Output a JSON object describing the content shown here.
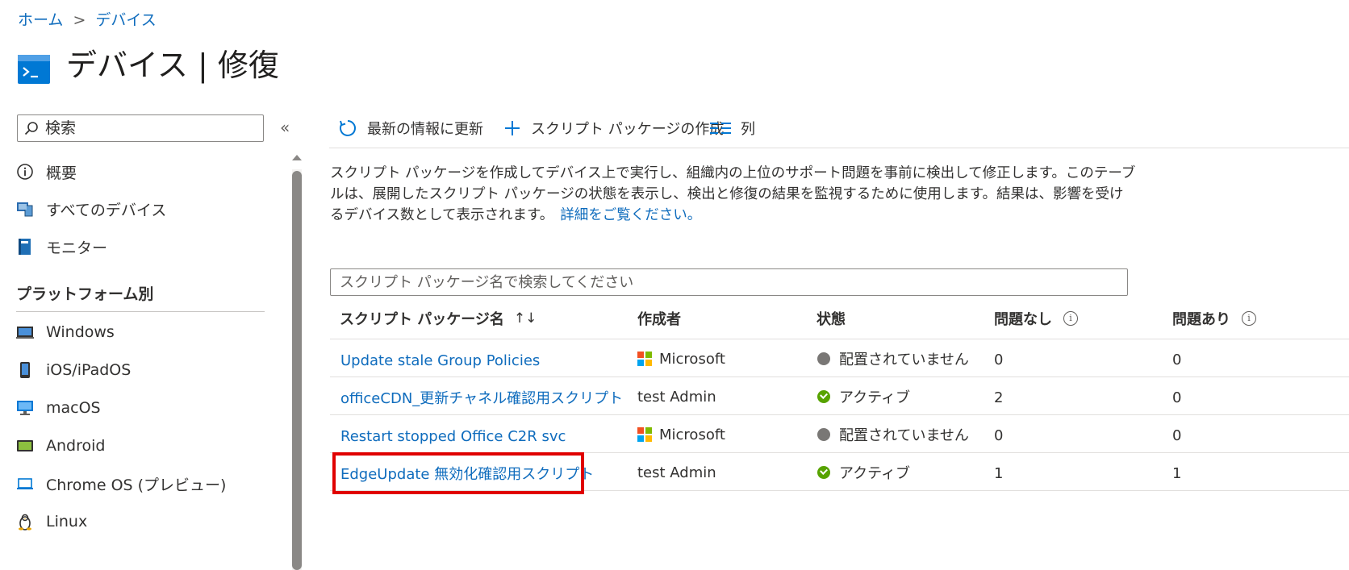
{
  "breadcrumb": {
    "home": "ホーム",
    "separator": ">",
    "current": "デバイス"
  },
  "page": {
    "title": "デバイス | 修復",
    "more": "···"
  },
  "sidebar": {
    "search_placeholder": "検索",
    "collapse": "«",
    "items": [
      {
        "label": "概要",
        "icon": "info-icon"
      },
      {
        "label": "すべてのデバイス",
        "icon": "devices-icon"
      },
      {
        "label": "モニター",
        "icon": "monitor-book-icon"
      }
    ],
    "section_title": "プラットフォーム別",
    "platforms": [
      {
        "label": "Windows",
        "icon": "windows-laptop-icon"
      },
      {
        "label": "iOS/iPadOS",
        "icon": "phone-icon"
      },
      {
        "label": "macOS",
        "icon": "desktop-icon"
      },
      {
        "label": "Android",
        "icon": "android-device-icon"
      },
      {
        "label": "Chrome OS (プレビュー)",
        "icon": "laptop-icon"
      },
      {
        "label": "Linux",
        "icon": "linux-icon"
      }
    ]
  },
  "toolbar": {
    "refresh": "最新の情報に更新",
    "create": "スクリプト パッケージの作成",
    "columns": "列"
  },
  "description": {
    "text": "スクリプト パッケージを作成してデバイス上で実行し、組織内の上位のサポート問題を事前に検出して修正します。このテーブルは、展開したスクリプト パッケージの状態を表示し、検出と修復の結果を監視するために使用します。結果は、影響を受けるデバイス数として表示されます。",
    "link": "詳細をご覧ください。"
  },
  "table": {
    "search_placeholder": "スクリプト パッケージ名で検索してください",
    "headers": {
      "name": "スクリプト パッケージ名",
      "sort": "↑↓",
      "author": "作成者",
      "status": "状態",
      "no_issues": "問題なし",
      "with_issues": "問題あり"
    },
    "info_glyph": "i",
    "rows": [
      {
        "name": "Update stale Group Policies",
        "author": "Microsoft",
        "author_logo": true,
        "status": "配置されていません",
        "status_kind": "gray",
        "no_issues": "0",
        "with_issues": "0"
      },
      {
        "name": "officeCDN_更新チャネル確認用スクリプト",
        "author": "test Admin",
        "author_logo": false,
        "status": "アクティブ",
        "status_kind": "green",
        "no_issues": "2",
        "with_issues": "0"
      },
      {
        "name": "Restart stopped Office C2R svc",
        "author": "Microsoft",
        "author_logo": true,
        "status": "配置されていません",
        "status_kind": "gray",
        "no_issues": "0",
        "with_issues": "0"
      },
      {
        "name": "EdgeUpdate 無効化確認用スクリプト",
        "author": "test Admin",
        "author_logo": false,
        "status": "アクティブ",
        "status_kind": "green",
        "no_issues": "1",
        "with_issues": "1"
      }
    ]
  },
  "colors": {
    "accent": "#0f6cbd",
    "highlight": "#e00000",
    "active": "#57a300",
    "inactive": "#797775"
  }
}
